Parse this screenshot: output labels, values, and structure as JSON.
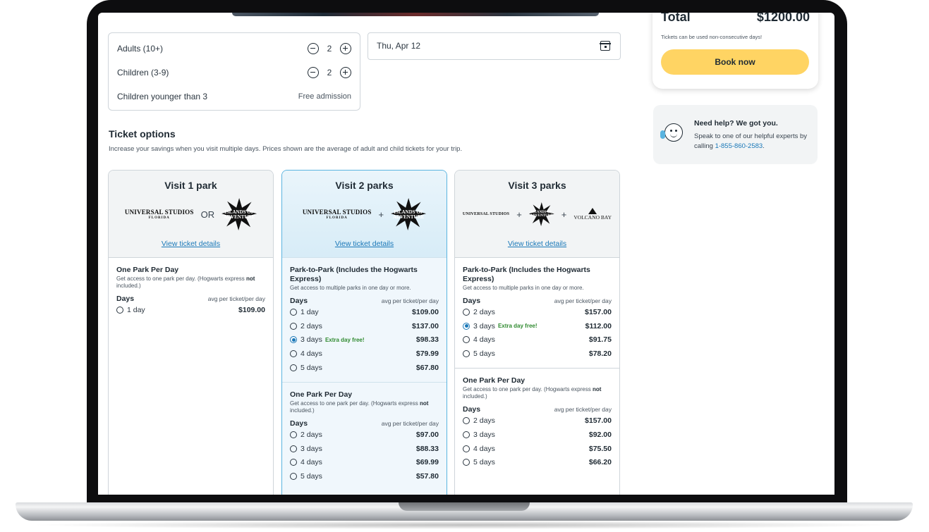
{
  "guests": {
    "adults_label": "Adults (10+)",
    "adults_count": "2",
    "children_label": "Children (3-9)",
    "children_count": "2",
    "infants_label": "Children younger than 3",
    "infants_note": "Free admission"
  },
  "date_field": {
    "value": "Thu, Apr 12"
  },
  "ticket_options": {
    "title": "Ticket options",
    "subtitle": "Increase your savings when you visit multiple days. Prices shown are the average of adult and child tickets for your trip."
  },
  "columns": [
    {
      "title": "Visit 1 park",
      "logo_join": "OR",
      "details_link": "View ticket details",
      "sections": [
        {
          "title": "One Park Per Day",
          "desc_pre": "Get access to one park per day. (Hogwarts express ",
          "desc_bold": "not",
          "desc_post": " included.)",
          "days_label": "Days",
          "avg_label": "avg per ticket/per day",
          "rows": [
            {
              "days": "1 day",
              "promo": "",
              "price": "$109.00",
              "selected": false
            }
          ]
        }
      ]
    },
    {
      "title": "Visit 2 parks",
      "logo_join": "+",
      "details_link": "View ticket details",
      "sections": [
        {
          "title": "Park-to-Park (Includes the Hogwarts Express)",
          "desc_pre": "Get access to multiple parks in one day or more.",
          "desc_bold": "",
          "desc_post": "",
          "days_label": "Days",
          "avg_label": "avg per ticket/per day",
          "rows": [
            {
              "days": "1 day",
              "promo": "",
              "price": "$109.00",
              "selected": false
            },
            {
              "days": "2 days",
              "promo": "",
              "price": "$137.00",
              "selected": false
            },
            {
              "days": "3 days",
              "promo": "Extra day free!",
              "price": "$98.33",
              "selected": true
            },
            {
              "days": "4 days",
              "promo": "",
              "price": "$79.99",
              "selected": false
            },
            {
              "days": "5 days",
              "promo": "",
              "price": "$67.80",
              "selected": false
            }
          ]
        },
        {
          "title": "One Park Per Day",
          "desc_pre": "Get access to one park per day. (Hogwarts express ",
          "desc_bold": "not",
          "desc_post": " included.)",
          "days_label": "Days",
          "avg_label": "avg per ticket/per day",
          "rows": [
            {
              "days": "2 days",
              "promo": "",
              "price": "$97.00",
              "selected": false
            },
            {
              "days": "3 days",
              "promo": "",
              "price": "$88.33",
              "selected": false
            },
            {
              "days": "4 days",
              "promo": "",
              "price": "$69.99",
              "selected": false
            },
            {
              "days": "5 days",
              "promo": "",
              "price": "$57.80",
              "selected": false
            }
          ]
        }
      ]
    },
    {
      "title": "Visit 3 parks",
      "logo_join": "+",
      "details_link": "View ticket details",
      "sections": [
        {
          "title": "Park-to-Park (Includes the Hogwarts Express)",
          "desc_pre": "Get access to multiple parks in one day or more.",
          "desc_bold": "",
          "desc_post": "",
          "days_label": "Days",
          "avg_label": "avg per ticket/per day",
          "rows": [
            {
              "days": "2 days",
              "promo": "",
              "price": "$157.00",
              "selected": false
            },
            {
              "days": "3 days",
              "promo": "Extra day free!",
              "price": "$112.00",
              "selected": true
            },
            {
              "days": "4 days",
              "promo": "",
              "price": "$91.75",
              "selected": false
            },
            {
              "days": "5 days",
              "promo": "",
              "price": "$78.20",
              "selected": false
            }
          ]
        },
        {
          "title": "One Park Per Day",
          "desc_pre": "Get access to one park per day. (Hogwarts express ",
          "desc_bold": "not",
          "desc_post": " included.)",
          "days_label": "Days",
          "avg_label": "avg per ticket/per day",
          "rows": [
            {
              "days": "2 days",
              "promo": "",
              "price": "$157.00",
              "selected": false
            },
            {
              "days": "3 days",
              "promo": "",
              "price": "$92.00",
              "selected": false
            },
            {
              "days": "4 days",
              "promo": "",
              "price": "$75.50",
              "selected": false
            },
            {
              "days": "5 days",
              "promo": "",
              "price": "$66.20",
              "selected": false
            }
          ]
        }
      ]
    }
  ],
  "logos": {
    "universal": "UNIVERSAL STUDIOS",
    "universal_sub": "FLORIDA",
    "islands": "ISLANDS OF ADVENTURE",
    "volcano": "VOLCANO BAY"
  },
  "summary": {
    "total_label": "Total",
    "total_value": "$1200.00",
    "note": "Tickets can be used non-consecutive days!",
    "book_label": "Book now"
  },
  "help": {
    "title": "Need help? We got you.",
    "text": "Speak to one of our helpful experts by calling ",
    "phone": "1-855-860-2583",
    "tail": "."
  },
  "colors": {
    "accent": "#1a78b8",
    "book_button": "#ffd463",
    "promo_green": "#2f8a2f",
    "selected_border": "#5ab4e0"
  },
  "icons": [
    "minus-circle-icon",
    "plus-circle-icon",
    "calendar-icon",
    "radio-icon",
    "support-agent-icon"
  ]
}
